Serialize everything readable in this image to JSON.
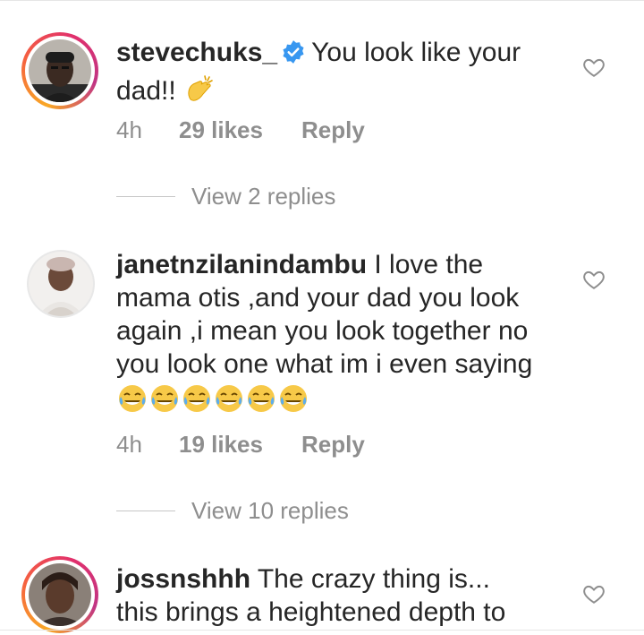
{
  "comments": [
    {
      "username": "stevechuks_",
      "verified": true,
      "text": "You look like your dad!!",
      "emoji": "👏",
      "time": "4h",
      "likes": "29 likes",
      "reply": "Reply",
      "view_replies": "View 2 replies",
      "story_ring": true
    },
    {
      "username": "janetnzilanindambu",
      "verified": false,
      "text": "I love the mama otis ,and your dad you look again ,i mean you look together no you look one what im i even saying",
      "emoji_count": 6,
      "time": "4h",
      "likes": "19 likes",
      "reply": "Reply",
      "view_replies": "View 10 replies",
      "story_ring": false
    },
    {
      "username": "jossnshhh",
      "verified": false,
      "text_line1": "The crazy thing is...",
      "text_line2": "this brings a heightened depth to",
      "story_ring": true
    }
  ],
  "icons": {
    "like": "heart-outline-icon",
    "verified": "verified-badge-icon",
    "clap": "clapping-hands-emoji",
    "laugh": "tears-of-joy-emoji"
  },
  "colors": {
    "text": "#262626",
    "meta": "#8e8e8e",
    "verified_blue": "#3897f0"
  }
}
